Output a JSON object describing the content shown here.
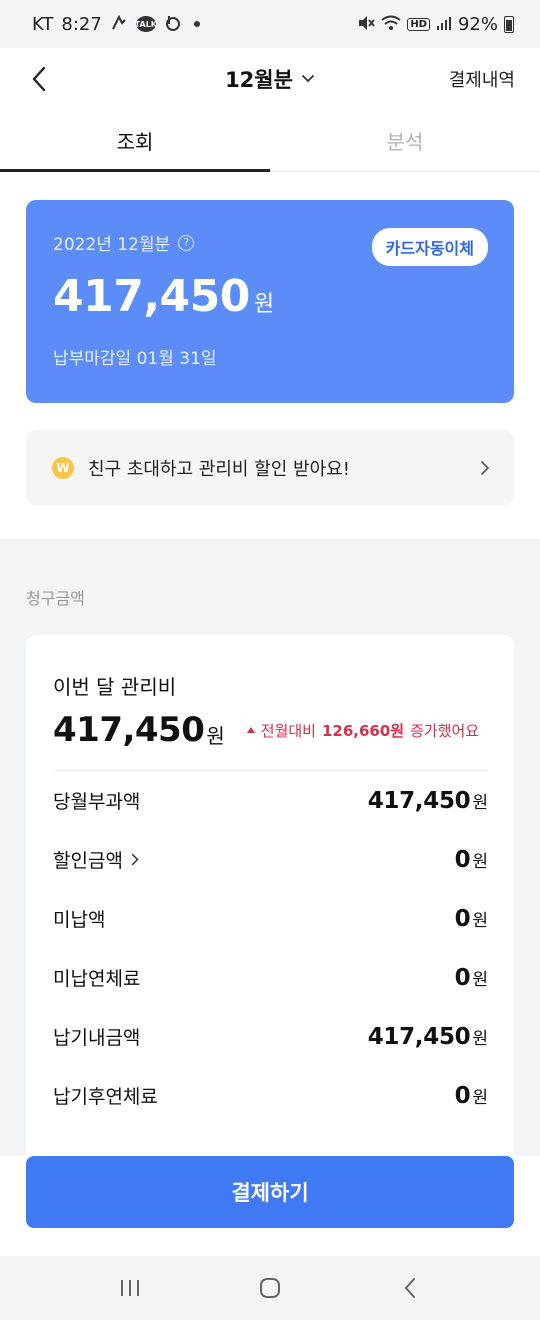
{
  "status_bar": {
    "carrier": "KT",
    "time": "8:27",
    "talk": "TALK",
    "battery": "92%"
  },
  "header": {
    "title": "12월분",
    "history_link": "결제내역"
  },
  "tabs": [
    {
      "label": "조회",
      "active": true
    },
    {
      "label": "분석",
      "active": false
    }
  ],
  "bill_card": {
    "period": "2022년 12월분",
    "help_icon": "?",
    "auto_pay_label": "카드자동이체",
    "amount": "417,450",
    "unit": "원",
    "due_text": "납부마감일 01월 31일"
  },
  "invite_banner": {
    "coin_label": "W",
    "text": "친구 초대하고 관리비 할인 받아요!"
  },
  "billing": {
    "section_label": "청구금액",
    "month_label": "이번 달 관리비",
    "month_amount": "417,450",
    "unit": "원",
    "compare_prefix": "전월대비",
    "compare_value": "126,660원",
    "compare_suffix": "증가했어요",
    "rows": [
      {
        "label": "당월부과액",
        "value": "417,450",
        "unit": "원",
        "has_chevron": false
      },
      {
        "label": "할인금액",
        "value": "0",
        "unit": "원",
        "has_chevron": true
      },
      {
        "label": "미납액",
        "value": "0",
        "unit": "원",
        "has_chevron": false
      },
      {
        "label": "미납연체료",
        "value": "0",
        "unit": "원",
        "has_chevron": false
      },
      {
        "label": "납기내금액",
        "value": "417,450",
        "unit": "원",
        "has_chevron": false
      },
      {
        "label": "납기후연체료",
        "value": "0",
        "unit": "원",
        "has_chevron": false
      }
    ]
  },
  "pay_button_label": "결제하기",
  "colors": {
    "card_blue": "#5b8cf8",
    "button_blue": "#3f79f3",
    "increase_red": "#d6304f"
  }
}
